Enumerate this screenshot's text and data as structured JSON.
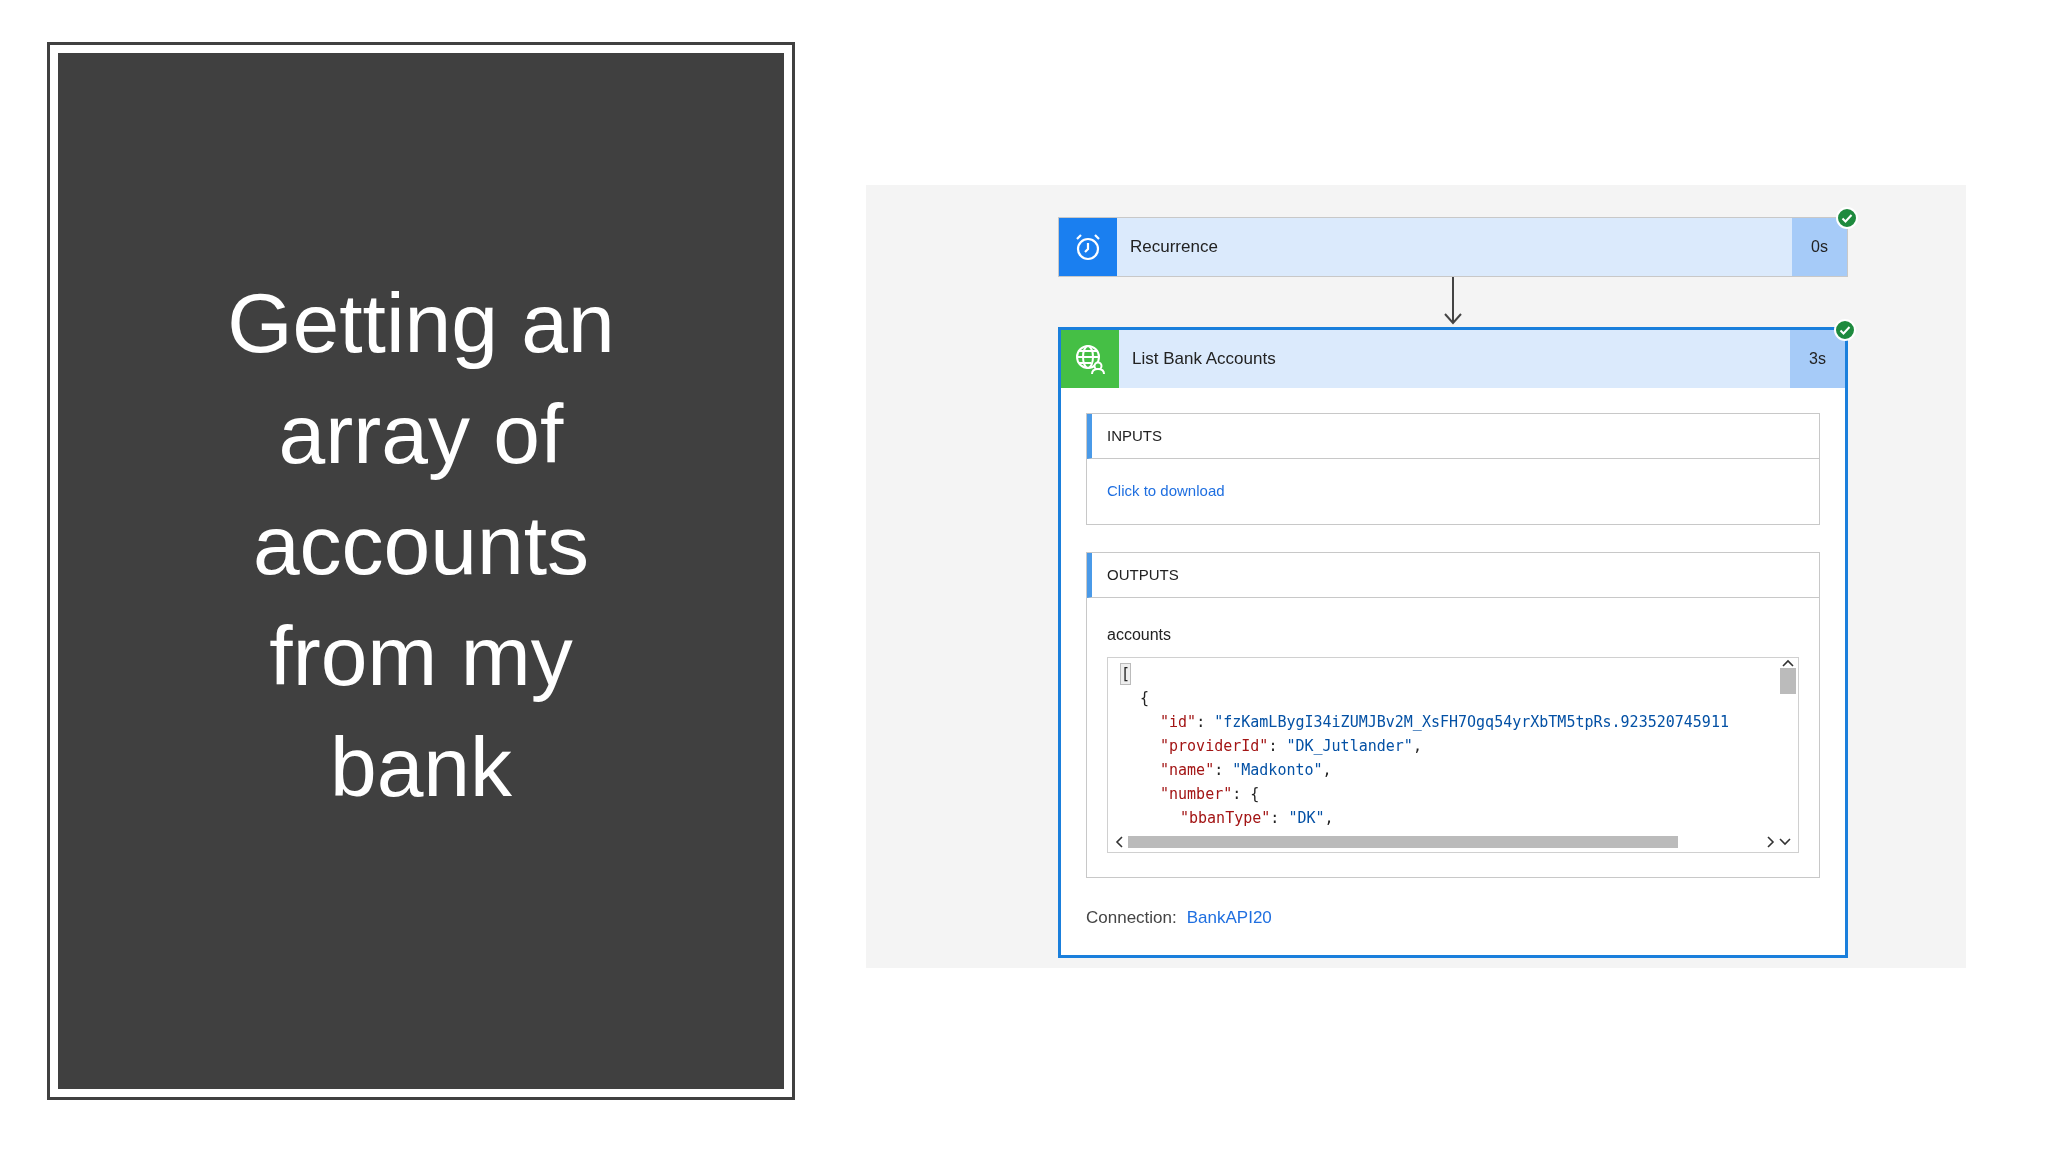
{
  "slide_title": "Getting an array of accounts from my bank",
  "flow": {
    "steps": [
      {
        "kind": "trigger",
        "title": "Recurrence",
        "duration": "0s",
        "succeeded": true
      },
      {
        "kind": "http",
        "title": "List Bank Accounts",
        "duration": "3s",
        "succeeded": true,
        "expanded": true,
        "inputs": {
          "heading": "INPUTS",
          "link": "Click to download"
        },
        "outputs": {
          "heading": "OUTPUTS",
          "field": "accounts",
          "code": [
            {
              "parts": [
                {
                  "kind": "punct",
                  "text": "["
                }
              ],
              "children": [
                {
                  "parts": [
                    {
                      "kind": "punct",
                      "text": "{"
                    }
                  ],
                  "children": [
                    {
                      "parts": [
                        {
                          "kind": "key",
                          "text": "\"id\""
                        },
                        {
                          "kind": "punct",
                          "text": ": "
                        },
                        {
                          "kind": "string",
                          "text": "\"fzKamLBygI34iZUMJBv2M_XsFH7Ogq54yrXbTM5tpRs.923520745911"
                        }
                      ]
                    },
                    {
                      "parts": [
                        {
                          "kind": "key",
                          "text": "\"providerId\""
                        },
                        {
                          "kind": "punct",
                          "text": ": "
                        },
                        {
                          "kind": "string",
                          "text": "\"DK_Jutlander\""
                        },
                        {
                          "kind": "punct",
                          "text": ","
                        }
                      ]
                    },
                    {
                      "parts": [
                        {
                          "kind": "key",
                          "text": "\"name\""
                        },
                        {
                          "kind": "punct",
                          "text": ": "
                        },
                        {
                          "kind": "string",
                          "text": "\"Madkonto\""
                        },
                        {
                          "kind": "punct",
                          "text": ","
                        }
                      ]
                    },
                    {
                      "parts": [
                        {
                          "kind": "key",
                          "text": "\"number\""
                        },
                        {
                          "kind": "punct",
                          "text": ": {"
                        }
                      ],
                      "children": [
                        {
                          "parts": [
                            {
                              "kind": "key",
                              "text": "\"bbanType\""
                            },
                            {
                              "kind": "punct",
                              "text": ": "
                            },
                            {
                              "kind": "string",
                              "text": "\"DK\""
                            },
                            {
                              "kind": "punct",
                              "text": ","
                            }
                          ]
                        }
                      ]
                    }
                  ]
                }
              ]
            }
          ]
        },
        "connection_label": "Connection:",
        "connection": "BankAPI20"
      }
    ]
  }
}
